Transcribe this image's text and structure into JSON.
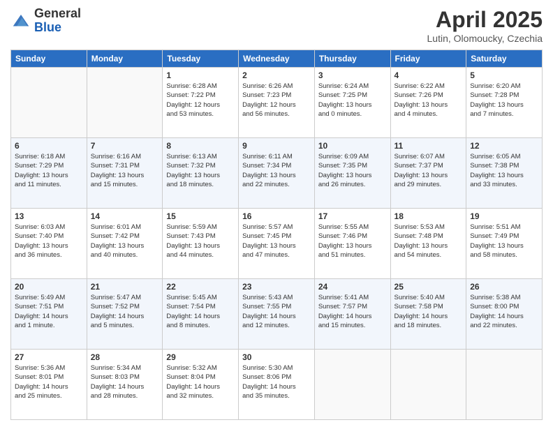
{
  "header": {
    "logo_general": "General",
    "logo_blue": "Blue",
    "title": "April 2025",
    "subtitle": "Lutin, Olomoucky, Czechia"
  },
  "calendar": {
    "days_of_week": [
      "Sunday",
      "Monday",
      "Tuesday",
      "Wednesday",
      "Thursday",
      "Friday",
      "Saturday"
    ],
    "weeks": [
      [
        {
          "day": "",
          "info": ""
        },
        {
          "day": "",
          "info": ""
        },
        {
          "day": "1",
          "info": "Sunrise: 6:28 AM\nSunset: 7:22 PM\nDaylight: 12 hours\nand 53 minutes."
        },
        {
          "day": "2",
          "info": "Sunrise: 6:26 AM\nSunset: 7:23 PM\nDaylight: 12 hours\nand 56 minutes."
        },
        {
          "day": "3",
          "info": "Sunrise: 6:24 AM\nSunset: 7:25 PM\nDaylight: 13 hours\nand 0 minutes."
        },
        {
          "day": "4",
          "info": "Sunrise: 6:22 AM\nSunset: 7:26 PM\nDaylight: 13 hours\nand 4 minutes."
        },
        {
          "day": "5",
          "info": "Sunrise: 6:20 AM\nSunset: 7:28 PM\nDaylight: 13 hours\nand 7 minutes."
        }
      ],
      [
        {
          "day": "6",
          "info": "Sunrise: 6:18 AM\nSunset: 7:29 PM\nDaylight: 13 hours\nand 11 minutes."
        },
        {
          "day": "7",
          "info": "Sunrise: 6:16 AM\nSunset: 7:31 PM\nDaylight: 13 hours\nand 15 minutes."
        },
        {
          "day": "8",
          "info": "Sunrise: 6:13 AM\nSunset: 7:32 PM\nDaylight: 13 hours\nand 18 minutes."
        },
        {
          "day": "9",
          "info": "Sunrise: 6:11 AM\nSunset: 7:34 PM\nDaylight: 13 hours\nand 22 minutes."
        },
        {
          "day": "10",
          "info": "Sunrise: 6:09 AM\nSunset: 7:35 PM\nDaylight: 13 hours\nand 26 minutes."
        },
        {
          "day": "11",
          "info": "Sunrise: 6:07 AM\nSunset: 7:37 PM\nDaylight: 13 hours\nand 29 minutes."
        },
        {
          "day": "12",
          "info": "Sunrise: 6:05 AM\nSunset: 7:38 PM\nDaylight: 13 hours\nand 33 minutes."
        }
      ],
      [
        {
          "day": "13",
          "info": "Sunrise: 6:03 AM\nSunset: 7:40 PM\nDaylight: 13 hours\nand 36 minutes."
        },
        {
          "day": "14",
          "info": "Sunrise: 6:01 AM\nSunset: 7:42 PM\nDaylight: 13 hours\nand 40 minutes."
        },
        {
          "day": "15",
          "info": "Sunrise: 5:59 AM\nSunset: 7:43 PM\nDaylight: 13 hours\nand 44 minutes."
        },
        {
          "day": "16",
          "info": "Sunrise: 5:57 AM\nSunset: 7:45 PM\nDaylight: 13 hours\nand 47 minutes."
        },
        {
          "day": "17",
          "info": "Sunrise: 5:55 AM\nSunset: 7:46 PM\nDaylight: 13 hours\nand 51 minutes."
        },
        {
          "day": "18",
          "info": "Sunrise: 5:53 AM\nSunset: 7:48 PM\nDaylight: 13 hours\nand 54 minutes."
        },
        {
          "day": "19",
          "info": "Sunrise: 5:51 AM\nSunset: 7:49 PM\nDaylight: 13 hours\nand 58 minutes."
        }
      ],
      [
        {
          "day": "20",
          "info": "Sunrise: 5:49 AM\nSunset: 7:51 PM\nDaylight: 14 hours\nand 1 minute."
        },
        {
          "day": "21",
          "info": "Sunrise: 5:47 AM\nSunset: 7:52 PM\nDaylight: 14 hours\nand 5 minutes."
        },
        {
          "day": "22",
          "info": "Sunrise: 5:45 AM\nSunset: 7:54 PM\nDaylight: 14 hours\nand 8 minutes."
        },
        {
          "day": "23",
          "info": "Sunrise: 5:43 AM\nSunset: 7:55 PM\nDaylight: 14 hours\nand 12 minutes."
        },
        {
          "day": "24",
          "info": "Sunrise: 5:41 AM\nSunset: 7:57 PM\nDaylight: 14 hours\nand 15 minutes."
        },
        {
          "day": "25",
          "info": "Sunrise: 5:40 AM\nSunset: 7:58 PM\nDaylight: 14 hours\nand 18 minutes."
        },
        {
          "day": "26",
          "info": "Sunrise: 5:38 AM\nSunset: 8:00 PM\nDaylight: 14 hours\nand 22 minutes."
        }
      ],
      [
        {
          "day": "27",
          "info": "Sunrise: 5:36 AM\nSunset: 8:01 PM\nDaylight: 14 hours\nand 25 minutes."
        },
        {
          "day": "28",
          "info": "Sunrise: 5:34 AM\nSunset: 8:03 PM\nDaylight: 14 hours\nand 28 minutes."
        },
        {
          "day": "29",
          "info": "Sunrise: 5:32 AM\nSunset: 8:04 PM\nDaylight: 14 hours\nand 32 minutes."
        },
        {
          "day": "30",
          "info": "Sunrise: 5:30 AM\nSunset: 8:06 PM\nDaylight: 14 hours\nand 35 minutes."
        },
        {
          "day": "",
          "info": ""
        },
        {
          "day": "",
          "info": ""
        },
        {
          "day": "",
          "info": ""
        }
      ]
    ]
  }
}
